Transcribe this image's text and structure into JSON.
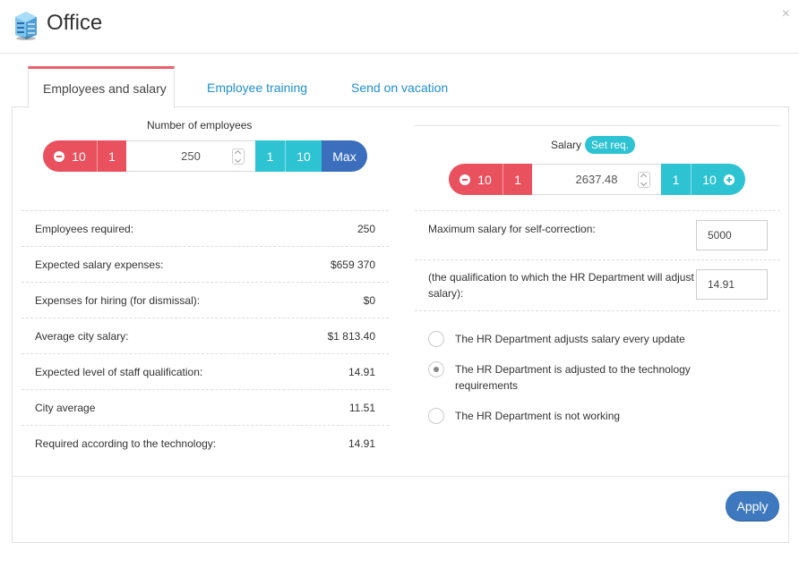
{
  "window": {
    "title": "Office",
    "close_label": "×"
  },
  "tabs": [
    {
      "label": "Employees and salary",
      "active": true
    },
    {
      "label": "Employee training",
      "active": false
    },
    {
      "label": "Send on vacation",
      "active": false
    }
  ],
  "employees": {
    "label": "Number of employees",
    "value": "250",
    "minus10": "10",
    "minus1": "1",
    "plus1": "1",
    "plus10": "10",
    "max_label": "Max"
  },
  "stats": [
    {
      "label": "Employees required:",
      "value": "250"
    },
    {
      "label": "Expected salary expenses:",
      "value": "$659 370"
    },
    {
      "label": "Expenses for hiring (for dismissal):",
      "value": "$0"
    },
    {
      "label": "Average city salary:",
      "value": "$1 813.40"
    },
    {
      "label": "Expected level of staff qualification:",
      "value": "14.91"
    },
    {
      "label": "City average",
      "value": "11.51"
    },
    {
      "label": "Required according to the technology:",
      "value": "14.91"
    }
  ],
  "salary": {
    "label": "Salary",
    "set_req_label": "Set req.",
    "value": "2637.48",
    "minus10": "10",
    "minus1": "1",
    "plus1": "1",
    "plus10": "10"
  },
  "hr": {
    "max_salary_label": "Maximum salary for self-correction:",
    "max_salary_value": "5000",
    "qualification_label": "(the qualification to which the HR Department will adjust salary):",
    "qualification_value": "14.91",
    "options": [
      {
        "label": "The HR Department adjusts salary every update",
        "checked": false
      },
      {
        "label": "The HR Department is adjusted to the technology requirements",
        "checked": true
      },
      {
        "label": "The HR Department is not working",
        "checked": false
      }
    ]
  },
  "footer": {
    "apply_label": "Apply"
  },
  "colors": {
    "red": "#e8515d",
    "teal": "#2ec3d3",
    "blue": "#3b6fbe",
    "tab_accent": "#e8616d",
    "link": "#1f8fd1"
  }
}
